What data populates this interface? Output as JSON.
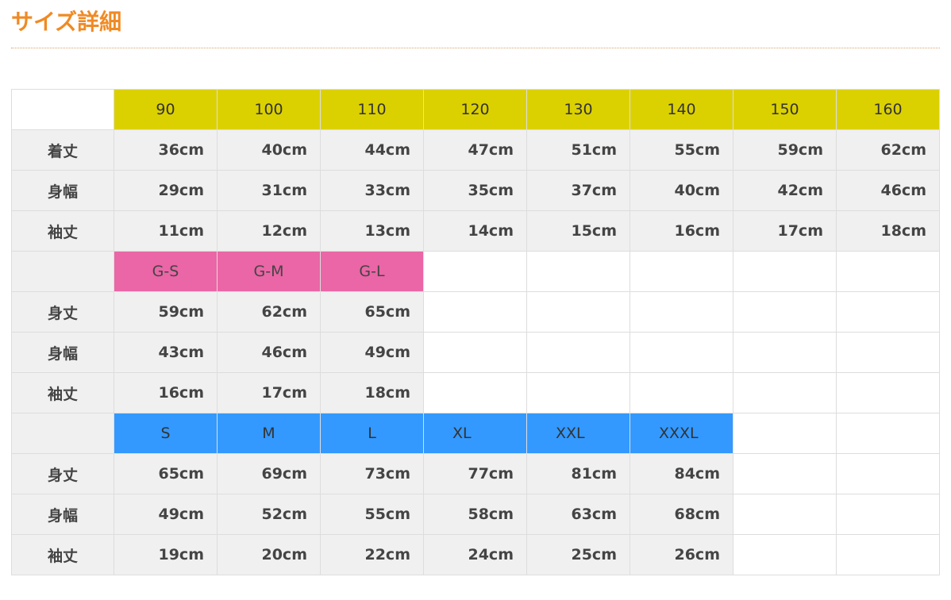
{
  "page": {
    "title": "サイズ詳細"
  },
  "colors": {
    "title": "#f08a24",
    "header_yellow": "#dcd100",
    "header_pink": "#ea66a6",
    "header_blue": "#3399ff",
    "cell_gray": "#f0f0f0"
  },
  "kids": {
    "sizes": [
      "90",
      "100",
      "110",
      "120",
      "130",
      "140",
      "150",
      "160"
    ],
    "rows": [
      {
        "label": "着丈",
        "values": [
          "36cm",
          "40cm",
          "44cm",
          "47cm",
          "51cm",
          "55cm",
          "59cm",
          "62cm"
        ]
      },
      {
        "label": "身幅",
        "values": [
          "29cm",
          "31cm",
          "33cm",
          "35cm",
          "37cm",
          "40cm",
          "42cm",
          "46cm"
        ]
      },
      {
        "label": "袖丈",
        "values": [
          "11cm",
          "12cm",
          "13cm",
          "14cm",
          "15cm",
          "16cm",
          "17cm",
          "18cm"
        ]
      }
    ]
  },
  "girls": {
    "sizes": [
      "G-S",
      "G-M",
      "G-L"
    ],
    "rows": [
      {
        "label": "身丈",
        "values": [
          "59cm",
          "62cm",
          "65cm"
        ]
      },
      {
        "label": "身幅",
        "values": [
          "43cm",
          "46cm",
          "49cm"
        ]
      },
      {
        "label": "袖丈",
        "values": [
          "16cm",
          "17cm",
          "18cm"
        ]
      }
    ]
  },
  "adult": {
    "sizes": [
      "S",
      "M",
      "L",
      "XL",
      "XXL",
      "XXXL"
    ],
    "rows": [
      {
        "label": "身丈",
        "values": [
          "65cm",
          "69cm",
          "73cm",
          "77cm",
          "81cm",
          "84cm"
        ]
      },
      {
        "label": "身幅",
        "values": [
          "49cm",
          "52cm",
          "55cm",
          "58cm",
          "63cm",
          "68cm"
        ]
      },
      {
        "label": "袖丈",
        "values": [
          "19cm",
          "20cm",
          "22cm",
          "24cm",
          "25cm",
          "26cm"
        ]
      }
    ]
  }
}
